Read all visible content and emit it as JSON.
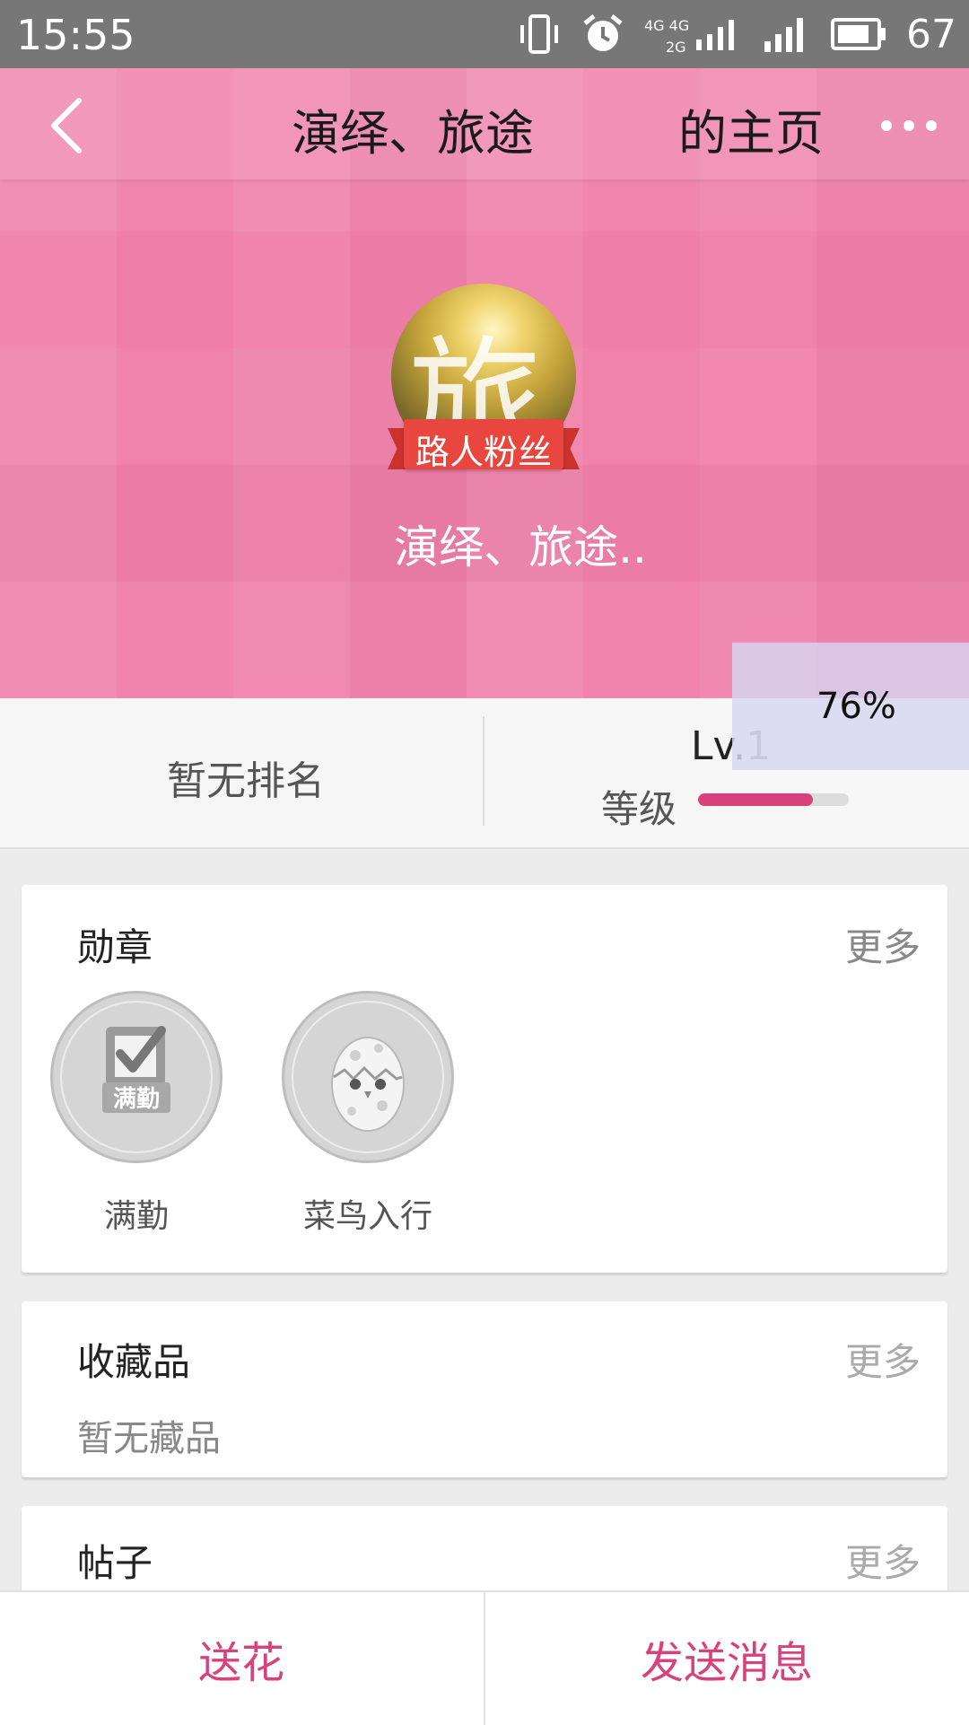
{
  "status_bar": {
    "time": "15:55",
    "battery": "67",
    "icons": [
      "vibrate-icon",
      "alarm-icon",
      "network-4g-icon",
      "signal-icon",
      "battery-icon"
    ],
    "network_top": "4G 4G",
    "network_bottom": "2G"
  },
  "header": {
    "title_left": "演绎、旅途",
    "title_right": "的主页",
    "back_icon": "chevron-left-icon",
    "more_icon": "more-dots-icon"
  },
  "profile": {
    "avatar_char": "旅",
    "badge_label": "路人粉丝",
    "nickname": "演绎、旅途.."
  },
  "stats": {
    "rank": "暂无排名",
    "level_prefix": "Lv.",
    "level_num": "1",
    "level_label": "等级",
    "progress": 0.76,
    "progress_text": "76%"
  },
  "medals": {
    "title": "勋章",
    "more": "更多",
    "items": [
      {
        "label": "满勤",
        "icon": "full-attendance-medal-icon",
        "inner_text": "满勤"
      },
      {
        "label": "菜鸟入行",
        "icon": "newbie-egg-medal-icon"
      }
    ]
  },
  "collections": {
    "title": "收藏品",
    "more": "更多",
    "empty": "暂无藏品"
  },
  "posts": {
    "title": "帖子",
    "more": "更多"
  },
  "bottom": {
    "send_flower": "送花",
    "send_message": "发送消息"
  },
  "colors": {
    "accent": "#d9417a",
    "hero": "#ef7ea9",
    "status_bar": "#777777"
  }
}
